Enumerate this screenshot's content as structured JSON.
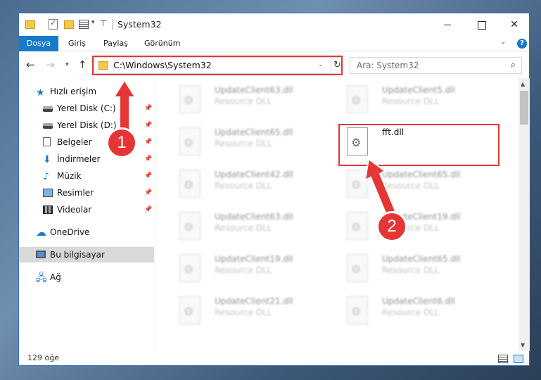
{
  "window": {
    "title": "System32",
    "controls": {
      "minimize": "",
      "maximize": "",
      "close": "✕"
    }
  },
  "ribbon": {
    "file_tab": "Dosya",
    "tabs": [
      "Giriş",
      "Paylaş",
      "Görünüm"
    ],
    "help": "?"
  },
  "nav": {
    "address": "C:\\Windows\\System32",
    "search_placeholder": "Ara: System32"
  },
  "sidebar": {
    "items": [
      {
        "label": "Hızlı erişim",
        "icon": "star-icon"
      },
      {
        "label": "Yerel Disk (C:)",
        "icon": "drive-icon",
        "pinned": true
      },
      {
        "label": "Yerel Disk (D:)",
        "icon": "drive-icon",
        "pinned": true
      },
      {
        "label": "Belgeler",
        "icon": "document-icon",
        "pinned": true
      },
      {
        "label": "İndirmeler",
        "icon": "download-icon",
        "pinned": true
      },
      {
        "label": "Müzik",
        "icon": "music-icon",
        "pinned": true
      },
      {
        "label": "Resimler",
        "icon": "pictures-icon",
        "pinned": true
      },
      {
        "label": "Videolar",
        "icon": "video-icon",
        "pinned": true
      },
      {
        "label": "OneDrive",
        "icon": "cloud-icon"
      },
      {
        "label": "Bu bilgisayar",
        "icon": "computer-icon",
        "selected": true
      },
      {
        "label": "Ağ",
        "icon": "network-icon"
      }
    ]
  },
  "files": [
    {
      "name": "UpdateClient63.dll",
      "desc": "Resource DLL"
    },
    {
      "name": "UpdateClient5.dll",
      "desc": "Resource DLL"
    },
    {
      "name": "UpdateClient65.dll",
      "desc": "Resource DLL"
    },
    {
      "name": "fft.dll",
      "desc": ""
    },
    {
      "name": "UpdateClient42.dll",
      "desc": "Resource DLL"
    },
    {
      "name": "UpdateClient65.dll",
      "desc": "Resource DLL"
    },
    {
      "name": "UpdateClient63.dll",
      "desc": "Resource DLL"
    },
    {
      "name": "UpdateClient19.dll",
      "desc": "Resource DLL"
    },
    {
      "name": "UpdateClient19.dll",
      "desc": "Resource DLL"
    },
    {
      "name": "UpdateClient65.dll",
      "desc": "Resource DLL"
    },
    {
      "name": "UpdateClient21.dll",
      "desc": "Resource DLL"
    },
    {
      "name": "UpdateClient6.dll",
      "desc": "Resource DLL"
    }
  ],
  "status": {
    "item_count": "129 öğe"
  },
  "annotations": {
    "step1": "1",
    "step2": "2",
    "color": "#e53535"
  }
}
